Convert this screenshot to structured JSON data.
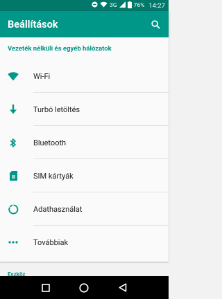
{
  "status_bar": {
    "battery": "76%",
    "time": "14:27",
    "network": "3G",
    "icons": [
      "dnd-icon",
      "wifi-icon",
      "signal-icon",
      "battery-icon"
    ]
  },
  "app_bar": {
    "title": "Beállítások",
    "search_icon": "search-icon"
  },
  "section": {
    "header": "Vezeték nélküli és egyéb hálózatok",
    "items": [
      {
        "label": "Wi-Fi",
        "icon": "wifi-icon"
      },
      {
        "label": "Turbó letöltés",
        "icon": "download-arrow-icon"
      },
      {
        "label": "Bluetooth",
        "icon": "bluetooth-icon"
      },
      {
        "label": "SIM kártyák",
        "icon": "sim-card-icon"
      },
      {
        "label": "Adathasználat",
        "icon": "data-usage-icon"
      },
      {
        "label": "Továbbiak",
        "icon": "more-dots-icon"
      }
    ]
  },
  "next_section": {
    "header": "Eszköz"
  },
  "colors": {
    "primary": "#009688",
    "primary_dark": "#00796b",
    "icon": "#009688"
  },
  "nav_bar": {
    "buttons": [
      "back-icon",
      "home-icon",
      "recents-icon"
    ]
  }
}
